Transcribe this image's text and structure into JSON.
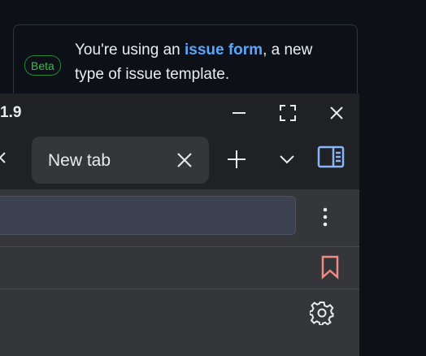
{
  "notice": {
    "badge": "Beta",
    "text_before": "You're using an ",
    "link_text": "issue form",
    "text_after": ", a new type of issue template."
  },
  "browser": {
    "version_text": "1.9",
    "tab": {
      "label": "New tab"
    },
    "colors": {
      "accent": "#8ab4f8",
      "bookmark": "#f28b82"
    }
  }
}
